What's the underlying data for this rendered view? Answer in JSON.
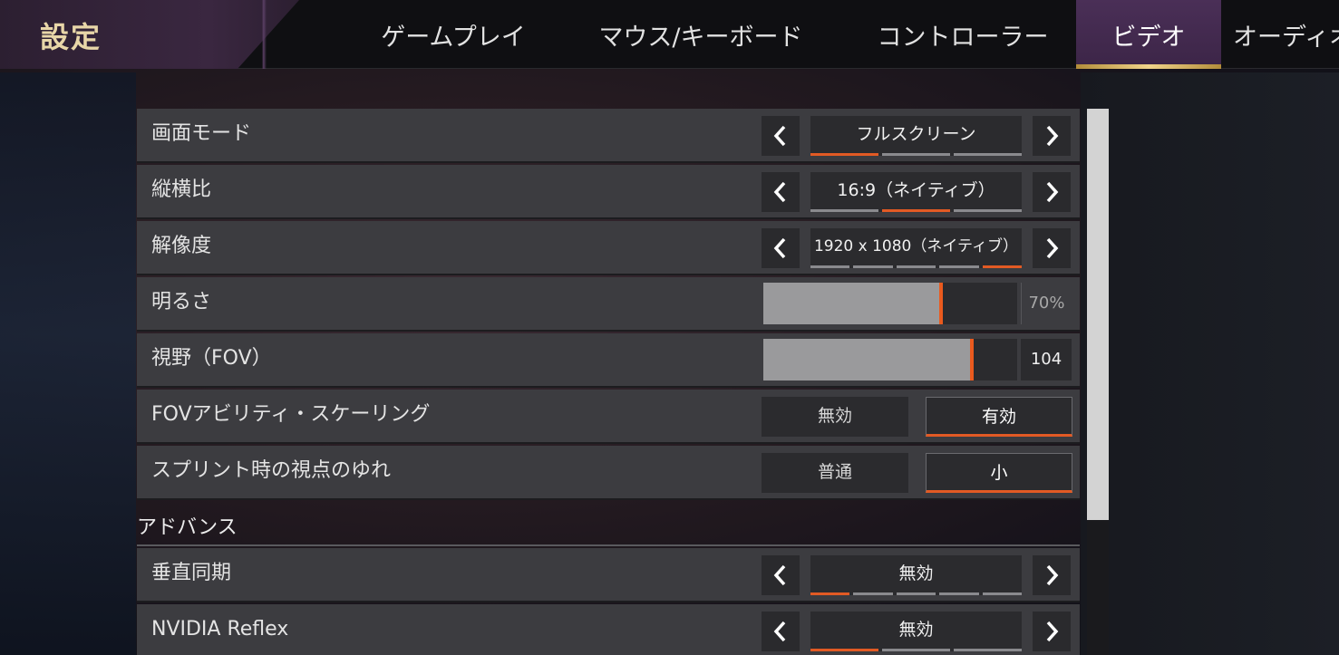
{
  "header": {
    "title": "設定",
    "tabs": [
      {
        "label": "ゲームプレイ",
        "active": false
      },
      {
        "label": "マウス/キーボード",
        "active": false
      },
      {
        "label": "コントローラー",
        "active": false
      },
      {
        "label": "ビデオ",
        "active": true
      },
      {
        "label": "オーディオ",
        "active": false
      }
    ]
  },
  "settings": {
    "display_mode": {
      "label": "画面モード",
      "value": "フルスクリーン",
      "segments": 3,
      "selected_index": 0
    },
    "aspect_ratio": {
      "label": "縦横比",
      "value": "16:9（ネイティブ）",
      "segments": 3,
      "selected_index": 1
    },
    "resolution": {
      "label": "解像度",
      "value": "1920 x 1080（ネイティブ）",
      "segments": 5,
      "selected_index": 4
    },
    "brightness": {
      "label": "明るさ",
      "value_text": "70%",
      "fill_fraction": 0.7
    },
    "fov": {
      "label": "視野（FOV）",
      "value_text": "104",
      "fill_fraction": 0.82
    },
    "fov_ability_scaling": {
      "label": "FOVアビリティ・スケーリング",
      "options": [
        "無効",
        "有効"
      ],
      "selected": "有効"
    },
    "sprint_view_shake": {
      "label": "スプリント時の視点のゆれ",
      "options": [
        "普通",
        "小"
      ],
      "selected": "小"
    }
  },
  "advanced": {
    "section_title": "アドバンス",
    "vsync": {
      "label": "垂直同期",
      "value": "無効",
      "segments": 5,
      "selected_index": 0
    },
    "nvidia_reflex": {
      "label": "NVIDIA Reflex",
      "value": "無効",
      "segments": 3,
      "selected_index": 0
    }
  },
  "colors": {
    "accent_orange": "#e25a24",
    "active_tab": "#4a2f57",
    "title_gold": "#e8d6a8",
    "row_bg": "#3c3c40"
  },
  "icons": {
    "prev": "chevron-left-icon",
    "next": "chevron-right-icon"
  }
}
